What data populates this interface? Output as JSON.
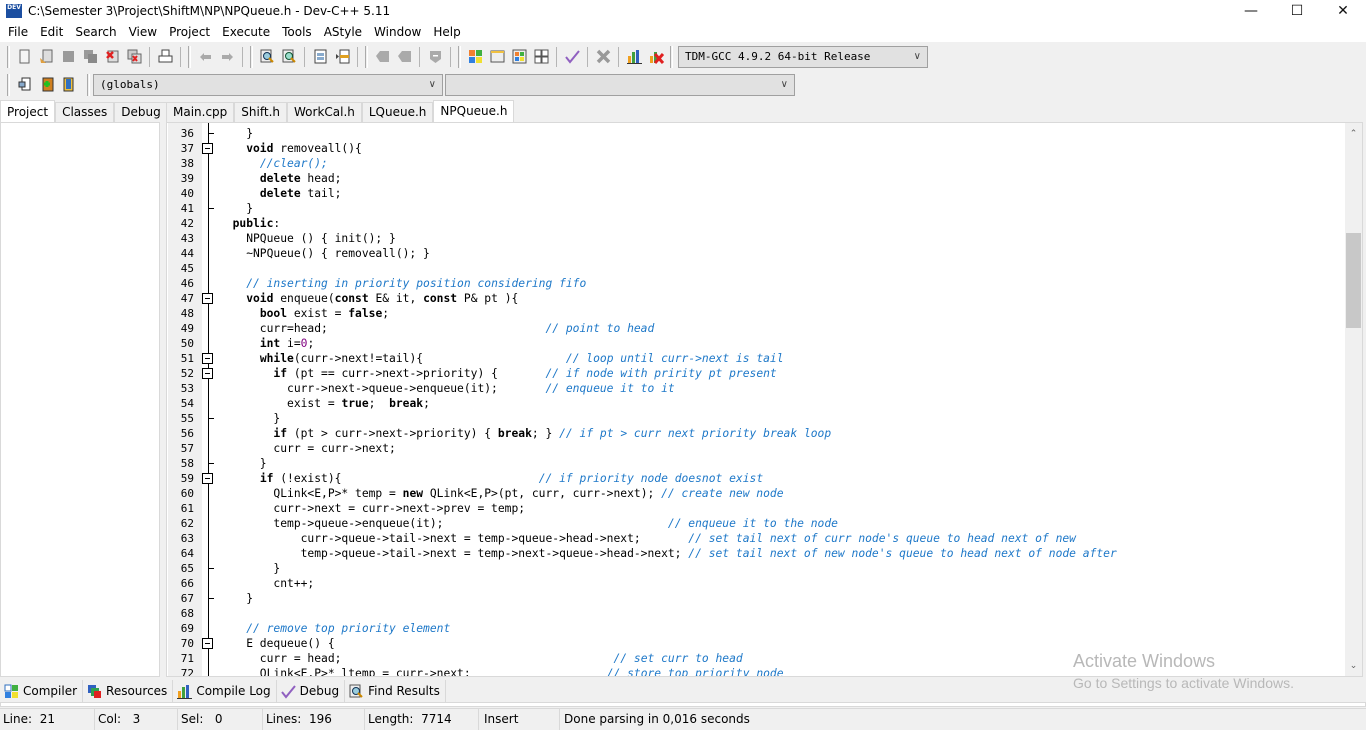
{
  "window": {
    "title": "C:\\Semester 3\\Project\\ShiftM\\NP\\NPQueue.h - Dev-C++ 5.11",
    "app_icon_label": "DEV",
    "minimize_glyph": "—",
    "maximize_glyph": "☐",
    "close_glyph": "✕"
  },
  "menu": [
    "File",
    "Edit",
    "Search",
    "View",
    "Project",
    "Execute",
    "Tools",
    "AStyle",
    "Window",
    "Help"
  ],
  "toolbar": {
    "compiler_select": "TDM-GCC 4.9.2 64-bit Release",
    "scope_select": "(globals)",
    "member_select": ""
  },
  "left_tabs": [
    "Project",
    "Classes",
    "Debug"
  ],
  "editor_tabs": [
    "Main.cpp",
    "Shift.h",
    "WorkCal.h",
    "LQueue.h",
    "NPQueue.h"
  ],
  "active_editor_tab": "NPQueue.h",
  "code_lines": [
    {
      "n": "36",
      "fold": "end",
      "code": [
        [
          "",
          "    }"
        ]
      ]
    },
    {
      "n": "37",
      "fold": "box",
      "code": [
        [
          "kw",
          "    void"
        ],
        [
          "",
          " removeall(){"
        ]
      ]
    },
    {
      "n": "38",
      "fold": "",
      "code": [
        [
          "",
          "      "
        ],
        [
          "cm",
          "//clear();"
        ]
      ]
    },
    {
      "n": "39",
      "fold": "",
      "code": [
        [
          "",
          "      "
        ],
        [
          "kw",
          "delete"
        ],
        [
          "",
          " head;"
        ]
      ]
    },
    {
      "n": "40",
      "fold": "",
      "code": [
        [
          "",
          "      "
        ],
        [
          "kw",
          "delete"
        ],
        [
          "",
          " tail;"
        ]
      ]
    },
    {
      "n": "41",
      "fold": "end",
      "code": [
        [
          "",
          "    }"
        ]
      ]
    },
    {
      "n": "42",
      "fold": "",
      "code": [
        [
          "kw",
          "  public"
        ],
        [
          "",
          ":"
        ]
      ]
    },
    {
      "n": "43",
      "fold": "",
      "code": [
        [
          "",
          "    NPQueue () { init(); }"
        ]
      ]
    },
    {
      "n": "44",
      "fold": "",
      "code": [
        [
          "",
          "    ~NPQueue() { removeall(); }"
        ]
      ]
    },
    {
      "n": "45",
      "fold": "",
      "code": [
        [
          "",
          ""
        ]
      ]
    },
    {
      "n": "46",
      "fold": "",
      "code": [
        [
          "",
          "    "
        ],
        [
          "cm",
          "// inserting in priority position considering fifo"
        ]
      ]
    },
    {
      "n": "47",
      "fold": "box",
      "code": [
        [
          "kw",
          "    void"
        ],
        [
          "",
          " enqueue("
        ],
        [
          "kw",
          "const"
        ],
        [
          "",
          " E& it, "
        ],
        [
          "kw",
          "const"
        ],
        [
          "",
          " P& pt ){"
        ]
      ]
    },
    {
      "n": "48",
      "fold": "",
      "code": [
        [
          "",
          "      "
        ],
        [
          "kw",
          "bool"
        ],
        [
          "",
          " exist = "
        ],
        [
          "kw",
          "false"
        ],
        [
          "",
          ";"
        ]
      ]
    },
    {
      "n": "49",
      "fold": "",
      "code": [
        [
          "",
          "      curr=head;                                "
        ],
        [
          "cm",
          "// point to head"
        ]
      ]
    },
    {
      "n": "50",
      "fold": "",
      "code": [
        [
          "",
          "      "
        ],
        [
          "kw",
          "int"
        ],
        [
          "",
          " i="
        ],
        [
          "num",
          "0"
        ],
        [
          "",
          ";"
        ]
      ]
    },
    {
      "n": "51",
      "fold": "box",
      "code": [
        [
          "",
          "      "
        ],
        [
          "kw",
          "while"
        ],
        [
          "",
          "(curr->next!=tail){                     "
        ],
        [
          "cm",
          "// loop until curr->next is tail"
        ]
      ]
    },
    {
      "n": "52",
      "fold": "box",
      "code": [
        [
          "",
          "        "
        ],
        [
          "kw",
          "if"
        ],
        [
          "",
          " (pt == curr->next->priority) {       "
        ],
        [
          "cm",
          "// if node with pririty pt present"
        ]
      ]
    },
    {
      "n": "53",
      "fold": "",
      "code": [
        [
          "",
          "          curr->next->queue->enqueue(it);       "
        ],
        [
          "cm",
          "// enqueue it to it"
        ]
      ]
    },
    {
      "n": "54",
      "fold": "",
      "code": [
        [
          "",
          "          exist = "
        ],
        [
          "kw",
          "true"
        ],
        [
          "",
          ";  "
        ],
        [
          "kw",
          "break"
        ],
        [
          "",
          ";"
        ]
      ]
    },
    {
      "n": "55",
      "fold": "end",
      "code": [
        [
          "",
          "        }"
        ]
      ]
    },
    {
      "n": "56",
      "fold": "",
      "code": [
        [
          "",
          "        "
        ],
        [
          "kw",
          "if"
        ],
        [
          "",
          " (pt > curr->next->priority) { "
        ],
        [
          "kw",
          "break"
        ],
        [
          "",
          "; } "
        ],
        [
          "cm",
          "// if pt > curr next priority break loop"
        ]
      ]
    },
    {
      "n": "57",
      "fold": "",
      "code": [
        [
          "",
          "        curr = curr->next;"
        ]
      ]
    },
    {
      "n": "58",
      "fold": "end",
      "code": [
        [
          "",
          "      }"
        ]
      ]
    },
    {
      "n": "59",
      "fold": "box",
      "code": [
        [
          "",
          "      "
        ],
        [
          "kw",
          "if"
        ],
        [
          "",
          " (!exist){                             "
        ],
        [
          "cm",
          "// if priority node doesnot exist"
        ]
      ]
    },
    {
      "n": "60",
      "fold": "",
      "code": [
        [
          "",
          "        QLink<E,P>* temp = "
        ],
        [
          "kw",
          "new"
        ],
        [
          "",
          " QLink<E,P>(pt, curr, curr->next); "
        ],
        [
          "cm",
          "// create new node"
        ]
      ]
    },
    {
      "n": "61",
      "fold": "",
      "code": [
        [
          "",
          "        curr->next = curr->next->prev = temp;"
        ]
      ]
    },
    {
      "n": "62",
      "fold": "",
      "code": [
        [
          "",
          "        temp->queue->enqueue(it);                                 "
        ],
        [
          "cm",
          "// enqueue it to the node"
        ]
      ]
    },
    {
      "n": "63",
      "fold": "",
      "code": [
        [
          "",
          "            curr->queue->tail->next = temp->queue->head->next;       "
        ],
        [
          "cm",
          "// set tail next of curr node's queue to head next of new"
        ]
      ]
    },
    {
      "n": "64",
      "fold": "",
      "code": [
        [
          "",
          "            temp->queue->tail->next = temp->next->queue->head->next; "
        ],
        [
          "cm",
          "// set tail next of new node's queue to head next of node after"
        ]
      ]
    },
    {
      "n": "65",
      "fold": "end",
      "code": [
        [
          "",
          "        }"
        ]
      ]
    },
    {
      "n": "66",
      "fold": "",
      "code": [
        [
          "",
          "        cnt++;"
        ]
      ]
    },
    {
      "n": "67",
      "fold": "end",
      "code": [
        [
          "",
          "    }"
        ]
      ]
    },
    {
      "n": "68",
      "fold": "",
      "code": [
        [
          "",
          ""
        ]
      ]
    },
    {
      "n": "69",
      "fold": "",
      "code": [
        [
          "",
          "    "
        ],
        [
          "cm",
          "// remove top priority element"
        ]
      ]
    },
    {
      "n": "70",
      "fold": "box",
      "code": [
        [
          "",
          "    E dequeue() {"
        ]
      ]
    },
    {
      "n": "71",
      "fold": "",
      "code": [
        [
          "",
          "      curr = head;                                        "
        ],
        [
          "cm",
          "// set curr to head"
        ]
      ]
    },
    {
      "n": "72",
      "fold": "",
      "code": [
        [
          "",
          "      QLink<E,P>* ltemp = curr->next;                    "
        ],
        [
          "cm",
          "// store top priority node"
        ]
      ]
    }
  ],
  "bottom_tabs": [
    "Compiler",
    "Resources",
    "Compile Log",
    "Debug",
    "Find Results"
  ],
  "status": {
    "line_label": "Line:",
    "line": "21",
    "col_label": "Col:",
    "col": "3",
    "sel_label": "Sel:",
    "sel": "0",
    "lines_label": "Lines:",
    "lines": "196",
    "length_label": "Length:",
    "length": "7714",
    "mode": "Insert",
    "message": "Done parsing in 0,016 seconds"
  },
  "watermark": {
    "title": "Activate Windows",
    "subtitle": "Go to Settings to activate Windows."
  },
  "colors": {
    "comment": "#1e78c8",
    "number": "#800080",
    "gutter_bg": "#f0f0f0"
  }
}
